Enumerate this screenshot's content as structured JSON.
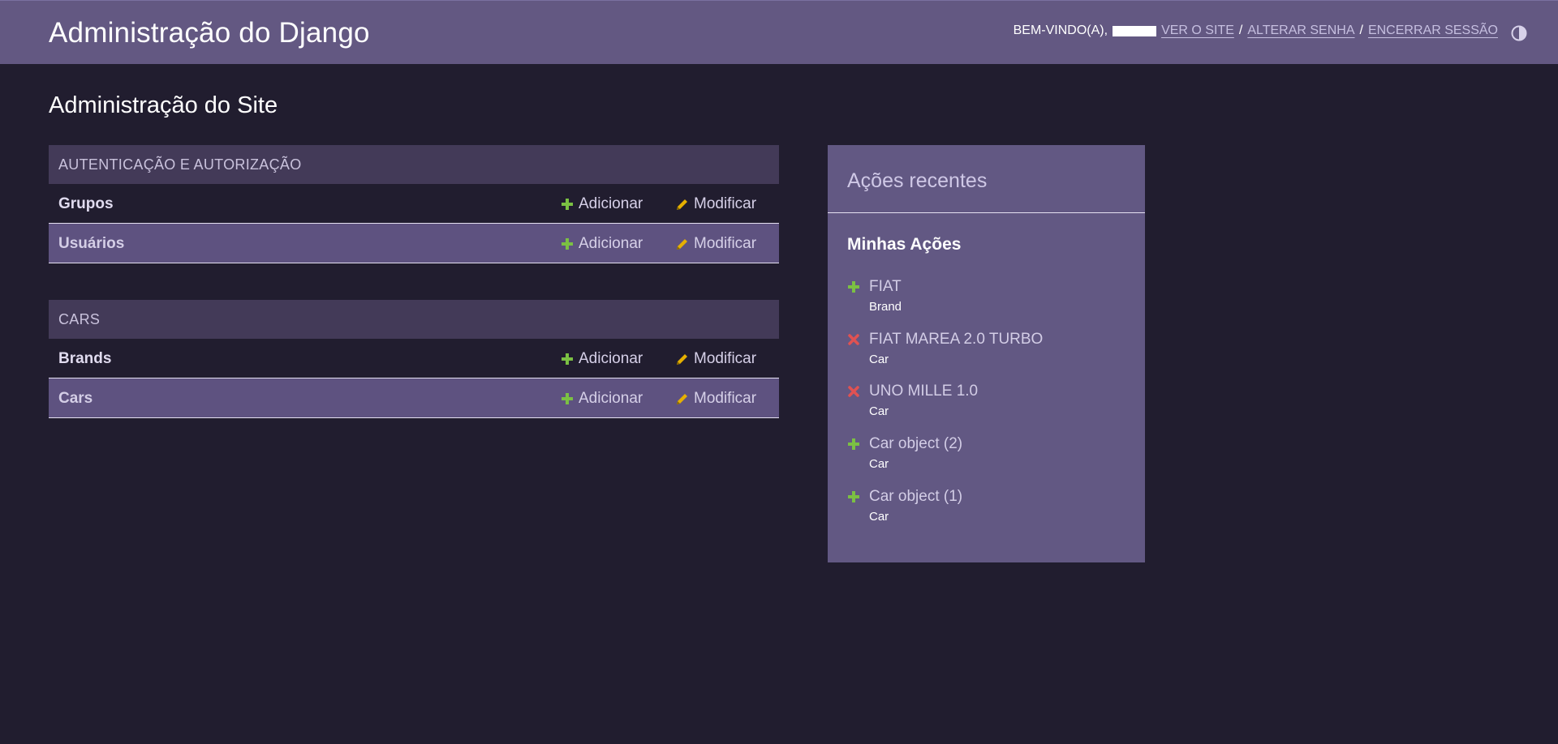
{
  "header": {
    "site_name": "Administração do Django",
    "welcome": "BEM-VINDO(A),",
    "view_site": "VER O SITE",
    "change_password": "ALTERAR SENHA",
    "logout": "ENCERRAR SESSÃO",
    "separator": "/"
  },
  "content": {
    "title": "Administração do Site"
  },
  "apps": [
    {
      "name": "AUTENTICAÇÃO E AUTORIZAÇÃO",
      "models": [
        {
          "name": "Grupos",
          "add": "Adicionar",
          "change": "Modificar"
        },
        {
          "name": "Usuários",
          "add": "Adicionar",
          "change": "Modificar"
        }
      ]
    },
    {
      "name": "CARS",
      "models": [
        {
          "name": "Brands",
          "add": "Adicionar",
          "change": "Modificar"
        },
        {
          "name": "Cars",
          "add": "Adicionar",
          "change": "Modificar"
        }
      ]
    }
  ],
  "recent_actions": {
    "title": "Ações recentes",
    "subtitle": "Minhas Ações",
    "items": [
      {
        "icon": "plus-icon",
        "name": "FIAT",
        "type": "Brand"
      },
      {
        "icon": "delete-icon",
        "name": "FIAT MAREA 2.0 TURBO",
        "type": "Car"
      },
      {
        "icon": "delete-icon",
        "name": "UNO MILLE 1.0",
        "type": "Car"
      },
      {
        "icon": "plus-icon",
        "name": "Car object (2)",
        "type": "Car"
      },
      {
        "icon": "plus-icon",
        "name": "Car object (1)",
        "type": "Car"
      }
    ]
  },
  "colors": {
    "header_bg": "#635882",
    "page_bg": "#211d2f",
    "caption_bg": "#433a58",
    "alt_row_bg": "#5e5280",
    "add_icon": "#7bc043",
    "change_icon": "#e6b000",
    "delete_icon": "#e05252"
  }
}
